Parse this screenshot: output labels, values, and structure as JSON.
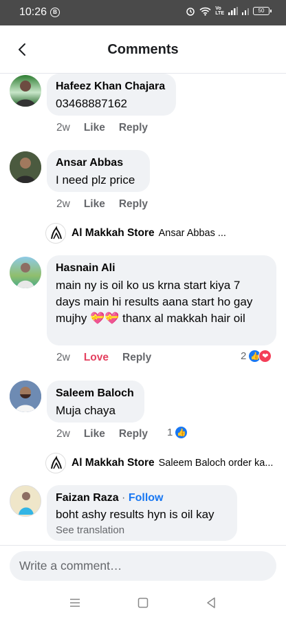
{
  "status_bar": {
    "time": "10:26",
    "b_label": "B",
    "net_label": "Vo\nLTE",
    "battery": "50"
  },
  "header": {
    "title": "Comments"
  },
  "comments": [
    {
      "name": "Hafeez Khan Chajara",
      "text": "03468887162",
      "time": "2w",
      "like": "Like",
      "reply": "Reply"
    },
    {
      "name": "Ansar Abbas",
      "text": "I need plz price",
      "time": "2w",
      "like": "Like",
      "reply": "Reply"
    },
    {
      "name": "Hasnain Ali",
      "text": "main ny is oil ko us krna start kiya 7 days main hi results aana start ho gay mujhy 💝💝 thanx al makkah hair oil",
      "time": "2w",
      "like": "Love",
      "reply": "Reply",
      "reaction_count": "2"
    },
    {
      "name": "Saleem Baloch",
      "text": "Muja chaya",
      "time": "2w",
      "like": "Like",
      "reply": "Reply",
      "reaction_count": "1"
    },
    {
      "name": "Faizan Raza",
      "follow": "Follow",
      "text": "boht ashy results hyn is oil kay",
      "see_translation": "See translation"
    }
  ],
  "store_replies": [
    {
      "name": "Al Makkah Store",
      "preview": "Ansar Abbas ..."
    },
    {
      "name": "Al Makkah Store",
      "preview": "Saleem Baloch order ka..."
    }
  ],
  "composer": {
    "placeholder": "Write a comment…"
  },
  "colors": {
    "accent": "#1877f2",
    "love": "#e4405f",
    "bubble": "#f0f2f5",
    "muted": "#65676b",
    "status_bar": "#4a4a4a"
  }
}
